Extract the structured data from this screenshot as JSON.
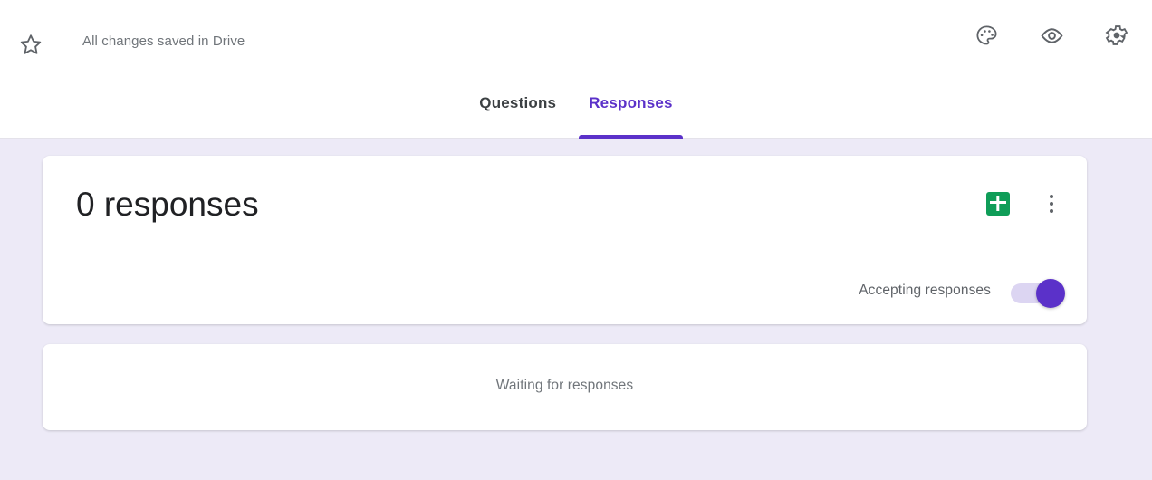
{
  "header": {
    "star_icon": "star-outline-icon",
    "saved_status": "All changes saved in Drive",
    "actions": [
      {
        "icon": "palette-icon",
        "label": "Customize theme"
      },
      {
        "icon": "eye-icon",
        "label": "Preview"
      },
      {
        "icon": "gear-icon",
        "label": "Settings"
      }
    ]
  },
  "tabs": [
    {
      "label": "Questions",
      "active": false
    },
    {
      "label": "Responses",
      "active": true
    }
  ],
  "summary": {
    "responses_heading": "0 responses",
    "sheets_icon": "google-sheets-icon",
    "kebab_icon": "more-options-icon",
    "accepting_label": "Accepting responses",
    "accepting_on": true
  },
  "waiting": {
    "message": "Waiting for responses"
  },
  "colors": {
    "accent_purple": "#5b31c9",
    "toggle_track": "#dcd5f2",
    "page_background": "#edeaf7",
    "sheets_green": "#0f9d58",
    "muted_text": "#70757a"
  }
}
